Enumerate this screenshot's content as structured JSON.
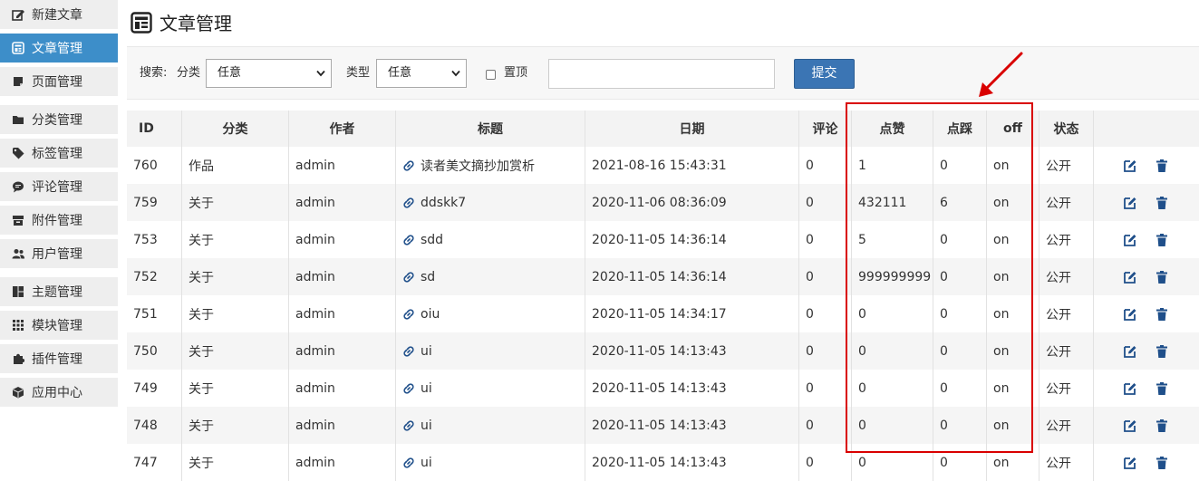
{
  "sidebar": {
    "items": [
      {
        "label": "新建文章",
        "icon": "edit-icon",
        "active": false
      },
      {
        "label": "文章管理",
        "icon": "article-icon",
        "active": true
      },
      {
        "label": "页面管理",
        "icon": "page-icon",
        "active": false
      },
      {
        "label": "分类管理",
        "icon": "folder-icon",
        "active": false
      },
      {
        "label": "标签管理",
        "icon": "tag-icon",
        "active": false
      },
      {
        "label": "评论管理",
        "icon": "comment-icon",
        "active": false
      },
      {
        "label": "附件管理",
        "icon": "archive-icon",
        "active": false
      },
      {
        "label": "用户管理",
        "icon": "users-icon",
        "active": false
      },
      {
        "label": "主题管理",
        "icon": "theme-icon",
        "active": false
      },
      {
        "label": "模块管理",
        "icon": "grid-icon",
        "active": false
      },
      {
        "label": "插件管理",
        "icon": "puzzle-icon",
        "active": false
      },
      {
        "label": "应用中心",
        "icon": "cube-icon",
        "active": false
      }
    ]
  },
  "header": {
    "title": "文章管理",
    "icon": "article-icon"
  },
  "filter": {
    "search_label": "搜索:",
    "category_label": "分类",
    "category_value": "任意",
    "type_label": "类型",
    "type_value": "任意",
    "top_label": "置顶",
    "top_checked": false,
    "keyword_value": "",
    "submit_label": "提交"
  },
  "table": {
    "columns": [
      "ID",
      "分类",
      "作者",
      "标题",
      "日期",
      "评论",
      "点赞",
      "点踩",
      "off",
      "状态",
      ""
    ],
    "rows": [
      {
        "id": "760",
        "category": "作品",
        "author": "admin",
        "title": "读者美文摘抄加赏析",
        "date": "2021-08-16 15:43:31",
        "comments": "0",
        "likes": "1",
        "dislikes": "0",
        "off": "on",
        "status": "公开"
      },
      {
        "id": "759",
        "category": "关于",
        "author": "admin",
        "title": "ddskk7",
        "date": "2020-11-06 08:36:09",
        "comments": "0",
        "likes": "432111",
        "dislikes": "6",
        "off": "on",
        "status": "公开"
      },
      {
        "id": "753",
        "category": "关于",
        "author": "admin",
        "title": "sdd",
        "date": "2020-11-05 14:36:14",
        "comments": "0",
        "likes": "5",
        "dislikes": "0",
        "off": "on",
        "status": "公开"
      },
      {
        "id": "752",
        "category": "关于",
        "author": "admin",
        "title": "sd",
        "date": "2020-11-05 14:36:14",
        "comments": "0",
        "likes": "999999999",
        "dislikes": "0",
        "off": "on",
        "status": "公开"
      },
      {
        "id": "751",
        "category": "关于",
        "author": "admin",
        "title": "oiu",
        "date": "2020-11-05 14:34:17",
        "comments": "0",
        "likes": "0",
        "dislikes": "0",
        "off": "on",
        "status": "公开"
      },
      {
        "id": "750",
        "category": "关于",
        "author": "admin",
        "title": "ui",
        "date": "2020-11-05 14:13:43",
        "comments": "0",
        "likes": "0",
        "dislikes": "0",
        "off": "on",
        "status": "公开"
      },
      {
        "id": "749",
        "category": "关于",
        "author": "admin",
        "title": "ui",
        "date": "2020-11-05 14:13:43",
        "comments": "0",
        "likes": "0",
        "dislikes": "0",
        "off": "on",
        "status": "公开"
      },
      {
        "id": "748",
        "category": "关于",
        "author": "admin",
        "title": "ui",
        "date": "2020-11-05 14:13:43",
        "comments": "0",
        "likes": "0",
        "dislikes": "0",
        "off": "on",
        "status": "公开"
      },
      {
        "id": "747",
        "category": "关于",
        "author": "admin",
        "title": "ui",
        "date": "2020-11-05 14:13:43",
        "comments": "0",
        "likes": "0",
        "dislikes": "0",
        "off": "on",
        "status": "公开"
      }
    ]
  },
  "colors": {
    "accent": "#3d8ec9",
    "submit": "#3b75b4",
    "annotation": "#d90000",
    "icon_blue": "#1f4f8a"
  },
  "annotation": {
    "icon": "arrow-icon"
  }
}
